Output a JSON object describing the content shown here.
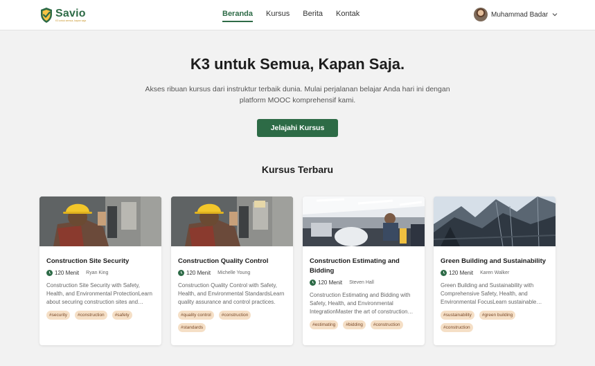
{
  "header": {
    "logo_name": "Savio",
    "logo_tagline": "K3 untuk semua, kapan saja",
    "nav": [
      {
        "label": "Beranda",
        "active": true
      },
      {
        "label": "Kursus",
        "active": false
      },
      {
        "label": "Berita",
        "active": false
      },
      {
        "label": "Kontak",
        "active": false
      }
    ],
    "user_name": "Muhammad Badar"
  },
  "hero": {
    "title": "K3 untuk Semua, Kapan Saja.",
    "subtitle": "Akses ribuan kursus dari instruktur terbaik dunia. Mulai perjalanan belajar Anda hari ini dengan platform MOOC komprehensif kami.",
    "cta_label": "Jelajahi Kursus"
  },
  "section_title": "Kursus Terbaru",
  "courses": [
    {
      "title": "Construction Site Security",
      "duration": "120 Menit",
      "author": "Ryan King",
      "description": "Construction Site Security with Safety, Health, and Environmental ProtectionLearn about securing construction sites and protecting assets.",
      "tags": [
        "#security",
        "#construction",
        "#safety"
      ]
    },
    {
      "title": "Construction Quality Control",
      "duration": "120 Menit",
      "author": "Michelle Young",
      "description": "Construction Quality Control with Safety, Health, and Environmental StandardsLearn quality assurance and control practices.",
      "tags": [
        "#quality control",
        "#construction",
        "#standards"
      ]
    },
    {
      "title": "Construction Estimating and Bidding",
      "duration": "120 Menit",
      "author": "Steven Hall",
      "description": "Construction Estimating and Bidding with Safety, Health, and Environmental IntegrationMaster the art of construction estimating.",
      "tags": [
        "#estimating",
        "#bidding",
        "#construction"
      ]
    },
    {
      "title": "Green Building and Sustainability",
      "duration": "120 Menit",
      "author": "Karen Walker",
      "description": "Green Building and Sustainability with Comprehensive Safety, Health, and Environmental FocusLearn sustainable building practices.",
      "tags": [
        "#sustainability",
        "#green building",
        "#construction"
      ]
    }
  ],
  "colors": {
    "brand": "#2e6b47",
    "cta": "#2d6b46",
    "tag_bg": "#f5dfc6",
    "tag_text": "#7a4a2a",
    "background": "#f2f2f2"
  },
  "icons": {
    "logo": "shield-check-icon",
    "user_menu": "chevron-down-icon",
    "duration": "clock-icon"
  }
}
